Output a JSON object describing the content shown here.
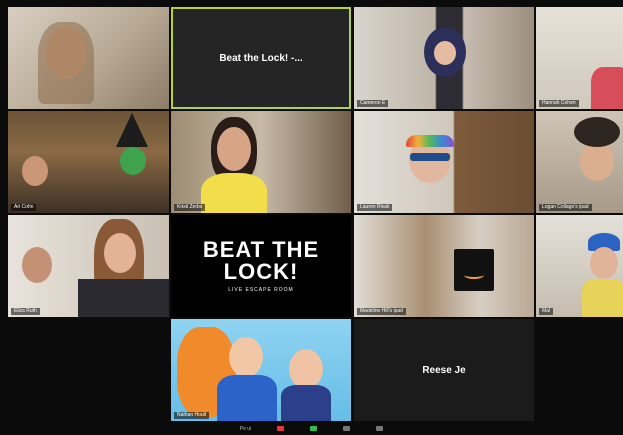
{
  "meeting": {
    "tiles": [
      {
        "id": "t1",
        "name": ""
      },
      {
        "id": "t2",
        "name": "Beat the Lock! -..."
      },
      {
        "id": "t3",
        "name": "Cameron E"
      },
      {
        "id": "t4",
        "name": "Hannah Cohen"
      },
      {
        "id": "t5",
        "name": "Ari Cohn"
      },
      {
        "id": "t6",
        "name": "Kristi Zerbs"
      },
      {
        "id": "t7",
        "name": "Lauren Rivak"
      },
      {
        "id": "t8",
        "name": "Logan Collage's ipad"
      },
      {
        "id": "t9",
        "name": "Eliza Ruth"
      },
      {
        "id": "t10",
        "name": ""
      },
      {
        "id": "t11",
        "name": "Madeline Hill's ipad"
      },
      {
        "id": "t12",
        "name": "Mal"
      },
      {
        "id": "t13",
        "name": "Nathan Hoult"
      },
      {
        "id": "t14",
        "name": "Reese Je"
      }
    ],
    "logo": {
      "line1": "BEAT THE",
      "line2": "LOCK!",
      "line3": "LIVE ESCAPE ROOM"
    },
    "toolbar": {
      "label": "Pe ui"
    }
  },
  "colors": {
    "active_speaker_border": "#b5d336",
    "background": "#0b0b0b",
    "tile_bg": "#1a1a1a",
    "unmute_red": "#e03a3a",
    "share_green": "#2fbf4f"
  }
}
